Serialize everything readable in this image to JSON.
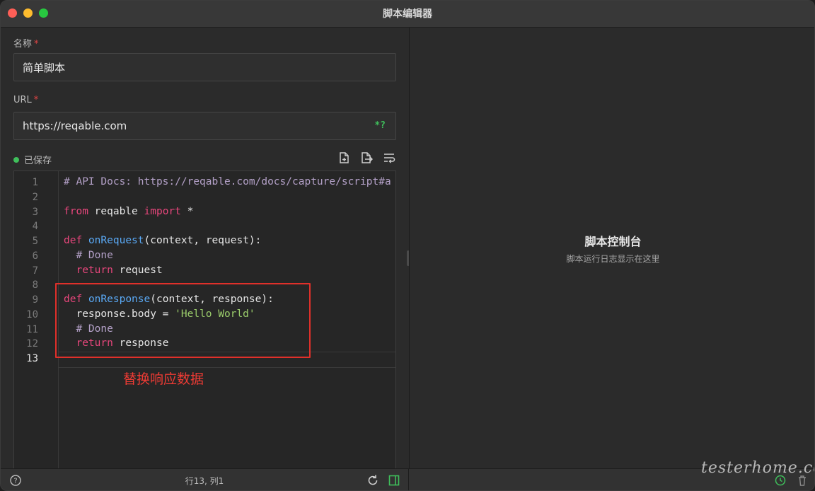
{
  "window": {
    "title": "脚本编辑器"
  },
  "form": {
    "name_label": "名称",
    "name_value": "简单脚本",
    "url_label": "URL",
    "url_value": "https://reqable.com",
    "required_mark": "*",
    "regex_button": "*?"
  },
  "status": {
    "saved": "已保存",
    "position": "行13, 列1"
  },
  "editor": {
    "line_numbers": [
      "1",
      "2",
      "3",
      "4",
      "5",
      "6",
      "7",
      "8",
      "9",
      "10",
      "11",
      "12",
      "13"
    ],
    "active_line": 13,
    "lines": [
      [
        {
          "t": "# API Docs: https://reqable.com/docs/capture/script#a",
          "c": "com"
        }
      ],
      [],
      [
        {
          "t": "from",
          "c": "kw"
        },
        {
          "t": " reqable ",
          "c": "plain"
        },
        {
          "t": "import",
          "c": "kw"
        },
        {
          "t": " *",
          "c": "plain"
        }
      ],
      [],
      [
        {
          "t": "def",
          "c": "kw"
        },
        {
          "t": " ",
          "c": "plain"
        },
        {
          "t": "onRequest",
          "c": "fn"
        },
        {
          "t": "(context, request):",
          "c": "plain"
        }
      ],
      [
        {
          "t": "  # Done",
          "c": "com"
        }
      ],
      [
        {
          "t": "  ",
          "c": "plain"
        },
        {
          "t": "return",
          "c": "kw"
        },
        {
          "t": " request",
          "c": "plain"
        }
      ],
      [],
      [
        {
          "t": "def",
          "c": "kw"
        },
        {
          "t": " ",
          "c": "plain"
        },
        {
          "t": "onResponse",
          "c": "fn"
        },
        {
          "t": "(context, response):",
          "c": "plain"
        }
      ],
      [
        {
          "t": "  response.body = ",
          "c": "plain"
        },
        {
          "t": "'Hello World'",
          "c": "str"
        }
      ],
      [
        {
          "t": "  # Done",
          "c": "com"
        }
      ],
      [
        {
          "t": "  ",
          "c": "plain"
        },
        {
          "t": "return",
          "c": "kw"
        },
        {
          "t": " response",
          "c": "plain"
        }
      ],
      []
    ]
  },
  "annotation": {
    "text": "替换响应数据",
    "color": "#ee3b34"
  },
  "console": {
    "title": "脚本控制台",
    "subtitle": "脚本运行日志显示在这里"
  },
  "watermark": "testerhome.com",
  "colors": {
    "keyword": "#e8467c",
    "function": "#5aa9f5",
    "comment": "#b3a0c7",
    "string": "#9bcd6b",
    "accent_green": "#3fbf5b"
  }
}
